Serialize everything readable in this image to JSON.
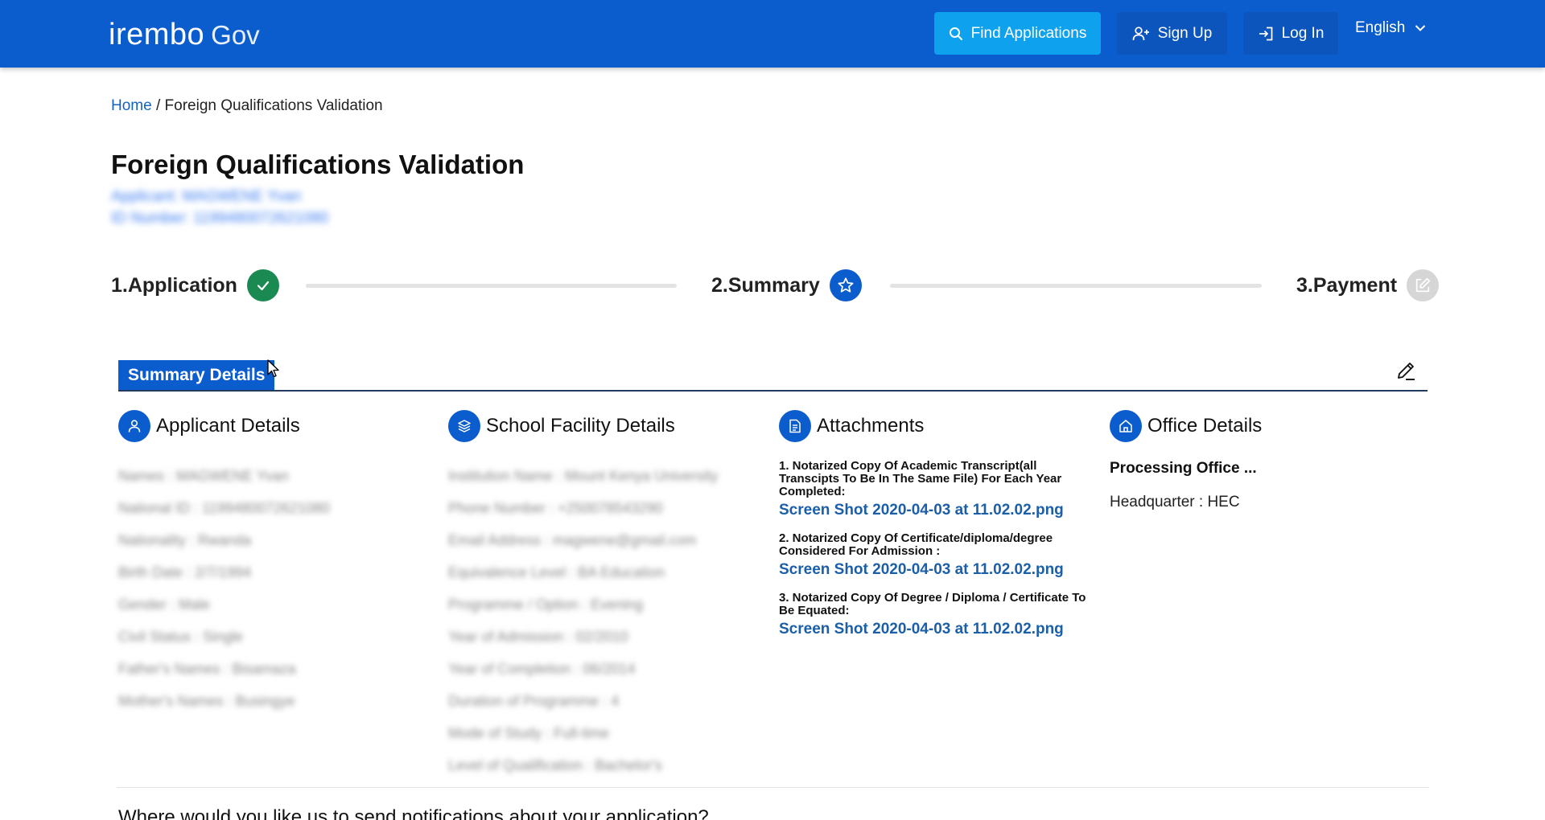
{
  "header": {
    "logo_main": "irembo",
    "logo_gov": "Gov",
    "find_label": "Find Applications",
    "signup_label": "Sign Up",
    "login_label": "Log In",
    "language": "English",
    "brand_color": "#0b5ccc",
    "find_color": "#0ea2ee"
  },
  "breadcrumb": {
    "home": "Home",
    "separator": " / ",
    "current": "Foreign Qualifications Validation"
  },
  "page": {
    "title": "Foreign Qualifications Validation",
    "applicant_line": "Applicant: MAGWENE Yvan",
    "id_line": "ID Number: 1199480072621080"
  },
  "stepper": {
    "steps": [
      {
        "label": "1.Application",
        "icon": "check-icon",
        "status": "complete",
        "color": "#1b8a52"
      },
      {
        "label": "2.Summary",
        "icon": "star-icon",
        "status": "current",
        "color": "#0b5ccc"
      },
      {
        "label": "3.Payment",
        "icon": "edit-square-icon",
        "status": "pending",
        "color": "#d6d6d6"
      }
    ]
  },
  "summary": {
    "tab_label": "Summary Details",
    "edit_icon": "pencil-icon",
    "columns": {
      "applicant": {
        "title": "Applicant Details",
        "icon": "person-icon",
        "items": [
          "Names : MAGWENE Yvan",
          "National ID : 1199480072621080",
          "Nationality : Rwanda",
          "Birth Date : 2/7/1994",
          "Gender : Male",
          "Civil Status : Single",
          "Father's Names : Bisamaza",
          "Mother's Names : Busingye"
        ]
      },
      "school": {
        "title": "School Facility Details",
        "icon": "layers-icon",
        "items": [
          "Institution Name : Mount Kenya University",
          "Phone Number : +250078543290",
          "Email Address : magwene@gmail.com",
          "Equivalence Level : BA Education",
          "Programme / Option : Evening",
          "Year of Admission : 02/2010",
          "Year of Completion : 06/2014",
          "Duration of Programme : 4",
          "Mode of Study : Full-time",
          "Level of Qualification : Bachelor's"
        ]
      },
      "attachments": {
        "title": "Attachments",
        "icon": "document-icon",
        "items": [
          {
            "label": "1. Notarized Copy Of Academic Transcript(all Transcipts To Be In The Same File) For Each Year Completed:",
            "file": "Screen Shot 2020-04-03 at 11.02.02.png"
          },
          {
            "label": "2. Notarized Copy Of Certificate/diploma/degree Considered For Admission :",
            "file": "Screen Shot 2020-04-03 at 11.02.02.png"
          },
          {
            "label": "3. Notarized Copy Of Degree / Diploma / Certificate To Be Equated:",
            "file": "Screen Shot 2020-04-03 at 11.02.02.png"
          }
        ]
      },
      "office": {
        "title": "Office Details",
        "icon": "home-icon",
        "processing_label": "Processing Office ...",
        "headquarter": "Headquarter : HEC"
      }
    }
  },
  "notifications": {
    "question": "Where would you like us to send notifications about your application?"
  }
}
